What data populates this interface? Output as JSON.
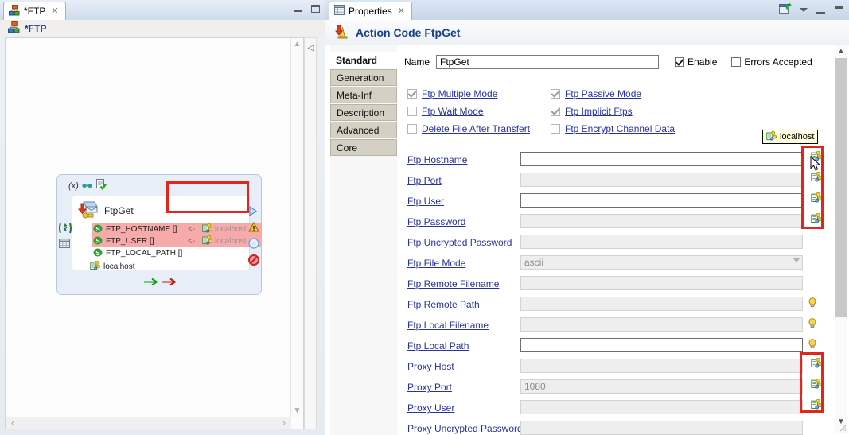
{
  "editor": {
    "tab": {
      "label": "*FTP",
      "icon": "hierarchy-icon",
      "close": "✕"
    },
    "title": "*FTP",
    "window_buttons": [
      "minimize",
      "maximize"
    ],
    "node": {
      "title": "FtpGet",
      "toolbar_icons": [
        "variable-x-icon",
        "link-icon",
        "document-check-icon"
      ],
      "variables": [
        {
          "name": "FTP_HOSTNAME []",
          "highlight": true,
          "arrow": "<-",
          "value": "localhost"
        },
        {
          "name": "FTP_USER []",
          "highlight": true,
          "arrow": "<-",
          "value": "localhost"
        },
        {
          "name": "FTP_LOCAL_PATH []",
          "highlight": false,
          "arrow": "",
          "value": ""
        }
      ],
      "context_label": "localhost",
      "left_icons": [
        "variable-green-icon",
        "table-icon"
      ],
      "right_icons": [
        "run-arrow-icon",
        "warning-icon",
        "circle-icon",
        "forbidden-icon"
      ],
      "flow_arrows": [
        "green-arrow",
        "red-arrow"
      ]
    },
    "hscroll": {
      "left_arrow": "‹",
      "right_arrow": "›"
    },
    "vscroll": {
      "up_arrow": "▲",
      "down_arrow": "▼"
    },
    "collapse_arrow": "◁"
  },
  "properties": {
    "tab": {
      "label": "Properties",
      "icon": "properties-table-icon",
      "close": "✕"
    },
    "toolbar_icons": [
      "pin-view-icon",
      "view-menu-icon",
      "minimize-icon",
      "maximize-icon"
    ],
    "title": "Action Code FtpGet",
    "title_icon": "action-code-icon",
    "tabs": [
      {
        "label": "Standard",
        "selected": true
      },
      {
        "label": "Generation",
        "selected": false
      },
      {
        "label": "Meta-Inf",
        "selected": false
      },
      {
        "label": "Description",
        "selected": false
      },
      {
        "label": "Advanced",
        "selected": false
      },
      {
        "label": "Core",
        "selected": false
      }
    ],
    "name_row": {
      "label": "Name",
      "value": "FtpGet",
      "placeholder": "",
      "enable": {
        "label": "Enable",
        "checked": true,
        "dim": false
      },
      "errors_accepted": {
        "label": "Errors Accepted",
        "checked": false,
        "dim": false
      }
    },
    "checkboxes": [
      {
        "label": "Ftp Multiple Mode",
        "checked": true,
        "dim": true,
        "col": 0,
        "row": 0
      },
      {
        "label": "Ftp Passive Mode",
        "checked": true,
        "dim": true,
        "col": 1,
        "row": 0
      },
      {
        "label": "Ftp Wait Mode",
        "checked": false,
        "dim": true,
        "col": 0,
        "row": 1
      },
      {
        "label": "Ftp Implicit Ftps",
        "checked": true,
        "dim": true,
        "col": 1,
        "row": 1
      },
      {
        "label": "Delete File After Transfert",
        "checked": false,
        "dim": true,
        "col": 0,
        "row": 2
      },
      {
        "label": "Ftp Encrypt Channel Data",
        "checked": false,
        "dim": true,
        "col": 1,
        "row": 2
      }
    ],
    "fields": [
      {
        "label": "Ftp Hostname",
        "value": "",
        "enabled": true,
        "type": "text",
        "ctx_icon": true,
        "bulb": false
      },
      {
        "label": "Ftp Port",
        "value": "",
        "enabled": false,
        "type": "text",
        "ctx_icon": true,
        "bulb": false
      },
      {
        "label": "Ftp User",
        "value": "",
        "enabled": true,
        "type": "text",
        "ctx_icon": true,
        "bulb": false
      },
      {
        "label": "Ftp Password",
        "value": "",
        "enabled": false,
        "type": "text",
        "ctx_icon": true,
        "bulb": false
      },
      {
        "label": "Ftp Uncrypted Password",
        "value": "",
        "enabled": false,
        "type": "text",
        "ctx_icon": false,
        "bulb": false
      },
      {
        "label": "Ftp File Mode",
        "value": "ascii",
        "enabled": false,
        "type": "combo",
        "ctx_icon": false,
        "bulb": false
      },
      {
        "label": "Ftp Remote Filename",
        "value": "",
        "enabled": false,
        "type": "text",
        "ctx_icon": false,
        "bulb": false
      },
      {
        "label": "Ftp Remote Path",
        "value": "",
        "enabled": false,
        "type": "text",
        "ctx_icon": false,
        "bulb": true
      },
      {
        "label": "Ftp Local Filename",
        "value": "",
        "enabled": false,
        "type": "text",
        "ctx_icon": false,
        "bulb": true
      },
      {
        "label": "Ftp Local Path",
        "value": "",
        "enabled": true,
        "type": "text",
        "ctx_icon": false,
        "bulb": true
      },
      {
        "label": "Proxy Host",
        "value": "",
        "enabled": false,
        "type": "text",
        "ctx_icon": true,
        "bulb": false
      },
      {
        "label": "Proxy Port",
        "value": "1080",
        "enabled": false,
        "type": "text",
        "ctx_icon": true,
        "bulb": false
      },
      {
        "label": "Proxy User",
        "value": "",
        "enabled": false,
        "type": "text",
        "ctx_icon": true,
        "bulb": false
      },
      {
        "label": "Proxy Uncrypted Password",
        "value": "",
        "enabled": false,
        "type": "text",
        "ctx_icon": false,
        "bulb": false
      }
    ],
    "tooltip": {
      "text": "localhost",
      "icon": "context-tree-icon"
    },
    "scrollbar": {
      "up_arrow": "▲",
      "down_arrow": "▼"
    }
  },
  "highlights": {
    "color": "#e2261c",
    "boxes": [
      "node-values-box",
      "context-icons-upper-box",
      "context-icons-lower-box"
    ]
  }
}
